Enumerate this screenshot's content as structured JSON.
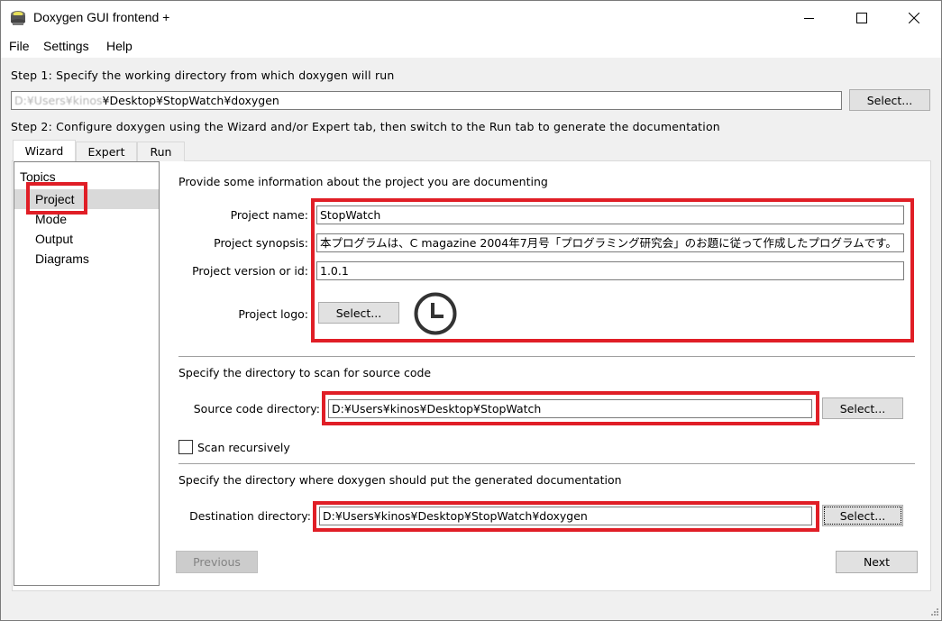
{
  "window": {
    "title": "Doxygen GUI frontend +",
    "icon": "doxygen-app-icon",
    "controls": {
      "minimize": "minimize-icon",
      "maximize": "maximize-icon",
      "close": "close-icon"
    }
  },
  "menubar": {
    "items": [
      {
        "label": "File"
      },
      {
        "label": "Settings"
      },
      {
        "label": "Help"
      }
    ]
  },
  "step1": {
    "label": "Step 1: Specify the working directory from which doxygen will run",
    "working_dir_blurred": "D:¥Users¥kinos",
    "working_dir_rest": "¥Desktop¥StopWatch¥doxygen",
    "select_label": "Select..."
  },
  "step2": {
    "label": "Step 2: Configure doxygen using the Wizard and/or Expert tab, then switch to the Run tab to generate the documentation"
  },
  "tabs": [
    {
      "label": "Wizard",
      "active": true
    },
    {
      "label": "Expert",
      "active": false
    },
    {
      "label": "Run",
      "active": false
    }
  ],
  "topics": {
    "header": "Topics",
    "items": [
      {
        "label": "Project",
        "selected": true
      },
      {
        "label": "Mode",
        "selected": false
      },
      {
        "label": "Output",
        "selected": false
      },
      {
        "label": "Diagrams",
        "selected": false
      }
    ]
  },
  "project": {
    "intro": "Provide some information about the project you are documenting",
    "name_label": "Project name:",
    "name_value": "StopWatch",
    "synopsis_label": "Project synopsis:",
    "synopsis_value": "本プログラムは、C magazine 2004年7月号「プログラミング研究会」のお題に従って作成したプログラムです。",
    "version_label": "Project version or id:",
    "version_value": "1.0.1",
    "logo_label": "Project logo:",
    "logo_select_label": "Select...",
    "logo_icon": "clock-icon"
  },
  "source": {
    "intro": "Specify the directory to scan for source code",
    "dir_label": "Source code directory:",
    "dir_value": "D:¥Users¥kinos¥Desktop¥StopWatch",
    "select_label": "Select...",
    "scan_recursively_label": "Scan recursively",
    "scan_recursively_checked": false
  },
  "destination": {
    "intro": "Specify the directory where doxygen should put the generated documentation",
    "dir_label": "Destination directory:",
    "dir_value": "D:¥Users¥kinos¥Desktop¥StopWatch¥doxygen",
    "select_label": "Select..."
  },
  "navigation": {
    "previous_label": "Previous",
    "previous_enabled": false,
    "next_label": "Next"
  },
  "annotations": {
    "highlight_color": "#e01e26"
  }
}
